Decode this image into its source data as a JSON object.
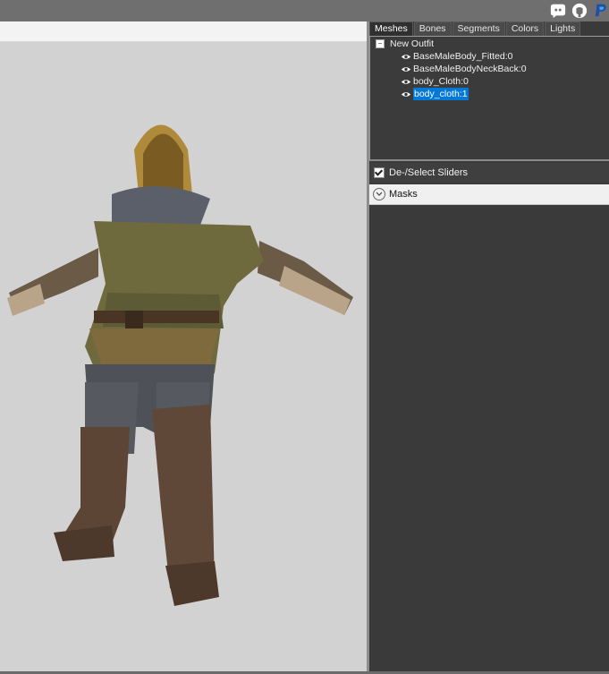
{
  "toolbar": {
    "icons": [
      "discord-icon",
      "github-icon",
      "paypal-icon"
    ]
  },
  "tabs": [
    "Meshes",
    "Bones",
    "Segments",
    "Colors",
    "Lights"
  ],
  "tree": {
    "root": "New Outfit",
    "items": [
      {
        "label": "BaseMaleBody_Fitted:0",
        "visible": true,
        "selected": false
      },
      {
        "label": "BaseMaleBodyNeckBack:0",
        "visible": true,
        "selected": false
      },
      {
        "label": "body_Cloth:0",
        "visible": true,
        "selected": false
      },
      {
        "label": "body_cloth:1",
        "visible": true,
        "selected": true
      }
    ]
  },
  "sliders": {
    "toggle_label": "De-/Select Sliders",
    "checked": true
  },
  "masks": {
    "label": "Masks"
  },
  "colors": {
    "selection": "#0078d7",
    "panel_bg": "#3a3a3a",
    "viewport_bg": "#d2d2d2"
  }
}
